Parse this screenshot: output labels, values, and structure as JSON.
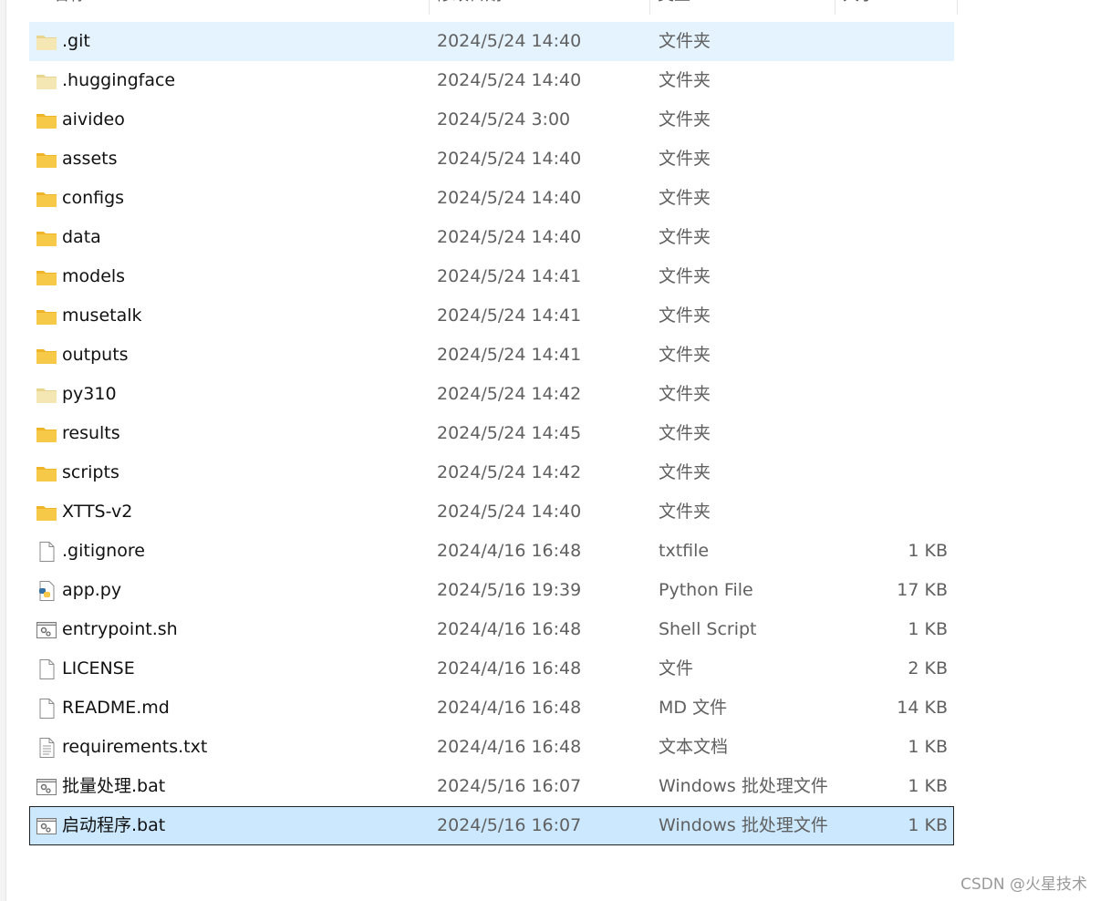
{
  "header": {
    "columns": [
      {
        "label": "名称"
      },
      {
        "label": "修改日期"
      },
      {
        "label": "类型"
      },
      {
        "label": "大小"
      }
    ]
  },
  "files": [
    {
      "name": ".git",
      "date": "2024/5/24 14:40",
      "type": "文件夹",
      "size": "",
      "icon": "folder-light-icon",
      "state": "hover"
    },
    {
      "name": ".huggingface",
      "date": "2024/5/24 14:40",
      "type": "文件夹",
      "size": "",
      "icon": "folder-light-icon",
      "state": ""
    },
    {
      "name": "aivideo",
      "date": "2024/5/24 3:00",
      "type": "文件夹",
      "size": "",
      "icon": "folder-icon",
      "state": ""
    },
    {
      "name": "assets",
      "date": "2024/5/24 14:40",
      "type": "文件夹",
      "size": "",
      "icon": "folder-icon",
      "state": ""
    },
    {
      "name": "configs",
      "date": "2024/5/24 14:40",
      "type": "文件夹",
      "size": "",
      "icon": "folder-icon",
      "state": ""
    },
    {
      "name": "data",
      "date": "2024/5/24 14:40",
      "type": "文件夹",
      "size": "",
      "icon": "folder-icon",
      "state": ""
    },
    {
      "name": "models",
      "date": "2024/5/24 14:41",
      "type": "文件夹",
      "size": "",
      "icon": "folder-icon",
      "state": ""
    },
    {
      "name": "musetalk",
      "date": "2024/5/24 14:41",
      "type": "文件夹",
      "size": "",
      "icon": "folder-icon",
      "state": ""
    },
    {
      "name": "outputs",
      "date": "2024/5/24 14:41",
      "type": "文件夹",
      "size": "",
      "icon": "folder-icon",
      "state": ""
    },
    {
      "name": "py310",
      "date": "2024/5/24 14:42",
      "type": "文件夹",
      "size": "",
      "icon": "folder-light-icon",
      "state": ""
    },
    {
      "name": "results",
      "date": "2024/5/24 14:45",
      "type": "文件夹",
      "size": "",
      "icon": "folder-icon",
      "state": ""
    },
    {
      "name": "scripts",
      "date": "2024/5/24 14:42",
      "type": "文件夹",
      "size": "",
      "icon": "folder-icon",
      "state": ""
    },
    {
      "name": "XTTS-v2",
      "date": "2024/5/24 14:40",
      "type": "文件夹",
      "size": "",
      "icon": "folder-icon",
      "state": ""
    },
    {
      "name": ".gitignore",
      "date": "2024/4/16 16:48",
      "type": "txtfile",
      "size": "1 KB",
      "icon": "blank-file-icon",
      "state": ""
    },
    {
      "name": "app.py",
      "date": "2024/5/16 19:39",
      "type": "Python File",
      "size": "17 KB",
      "icon": "python-file-icon",
      "state": ""
    },
    {
      "name": "entrypoint.sh",
      "date": "2024/4/16 16:48",
      "type": "Shell Script",
      "size": "1 KB",
      "icon": "script-file-icon",
      "state": ""
    },
    {
      "name": "LICENSE",
      "date": "2024/4/16 16:48",
      "type": "文件",
      "size": "2 KB",
      "icon": "blank-file-icon",
      "state": ""
    },
    {
      "name": "README.md",
      "date": "2024/4/16 16:48",
      "type": "MD 文件",
      "size": "14 KB",
      "icon": "blank-file-icon",
      "state": ""
    },
    {
      "name": "requirements.txt",
      "date": "2024/4/16 16:48",
      "type": "文本文档",
      "size": "1 KB",
      "icon": "text-file-icon",
      "state": ""
    },
    {
      "name": "批量处理.bat",
      "date": "2024/5/16 16:07",
      "type": "Windows 批处理文件",
      "size": "1 KB",
      "icon": "script-file-icon",
      "state": ""
    },
    {
      "name": "启动程序.bat",
      "date": "2024/5/16 16:07",
      "type": "Windows 批处理文件",
      "size": "1 KB",
      "icon": "script-file-icon",
      "state": "selected"
    }
  ],
  "watermark": "CSDN @火星技术",
  "colors": {
    "hover": "#e5f3ff",
    "selected": "#cce8ff",
    "folder": "#f7c948",
    "folder_light": "#f5e7b3"
  }
}
